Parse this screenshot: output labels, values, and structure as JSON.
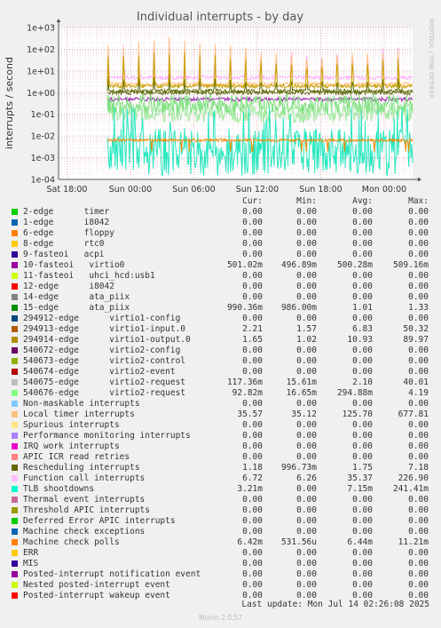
{
  "chart_data": {
    "type": "line",
    "title": "Individual interrupts - by day",
    "ylabel": "interrupts / second",
    "scale": "log",
    "ylim": [
      0.0001,
      1000
    ],
    "yticks": [
      "1e+03",
      "1e+02",
      "1e+01",
      "1e+00",
      "1e-01",
      "1e-02",
      "1e-03",
      "1e-04"
    ],
    "xticks": [
      "Sat 18:00",
      "Sun 00:00",
      "Sun 06:00",
      "Sun 12:00",
      "Sun 18:00",
      "Mon 00:00"
    ],
    "grid": true,
    "series": [
      {
        "name": "Function call interrupts",
        "color": "#ffb3ff",
        "base": 5,
        "spikes": 300
      },
      {
        "name": "Local timer interrupts",
        "color": "#ffc080",
        "base": 2.5,
        "spikes": 350
      },
      {
        "name": "10-fasteoi virtio0",
        "color": "#9c27b0",
        "base": 0.5,
        "spikes": 0.5
      },
      {
        "name": "15-edge ata_piix",
        "color": "#6b6b1a",
        "base": 1.0,
        "spikes": 1.3
      },
      {
        "name": "Rescheduling interrupts",
        "color": "#556b00",
        "base": 1.2,
        "spikes": 7
      },
      {
        "name": "294914-edge virtio1-output.0",
        "color": "#c8a000",
        "base": 2.0,
        "spikes": 90
      },
      {
        "name": "540675-edge virtio2-request",
        "color": "#a0e8a0",
        "base": 0.12,
        "spikes": 1
      },
      {
        "name": "540676-edge virtio2-request",
        "color": "#80e080",
        "base": 0.3,
        "spikes": 4
      },
      {
        "name": "TLB shootdowns",
        "color": "#28e8c0",
        "base": 0.003,
        "spikes": 0.24
      },
      {
        "name": "Machine check polls",
        "color": "#f08a00",
        "base": 0.0065,
        "spikes": 0.011
      }
    ]
  },
  "legend": {
    "headers": [
      "Cur:",
      "Min:",
      "Avg:",
      "Max:"
    ],
    "rows": [
      {
        "name": "2-edge      timer",
        "color": "#00cc00",
        "cur": "0.00",
        "min": "0.00",
        "avg": "0.00",
        "max": "0.00"
      },
      {
        "name": "1-edge      i8042",
        "color": "#0066b3",
        "cur": "0.00",
        "min": "0.00",
        "avg": "0.00",
        "max": "0.00"
      },
      {
        "name": "6-edge      floppy",
        "color": "#ff8000",
        "cur": "0.00",
        "min": "0.00",
        "avg": "0.00",
        "max": "0.00"
      },
      {
        "name": "8-edge      rtc0",
        "color": "#ffcc00",
        "cur": "0.00",
        "min": "0.00",
        "avg": "0.00",
        "max": "0.00"
      },
      {
        "name": "9-fasteoi   acpi",
        "color": "#330099",
        "cur": "0.00",
        "min": "0.00",
        "avg": "0.00",
        "max": "0.00"
      },
      {
        "name": "10-fasteoi   virtio0",
        "color": "#990099",
        "cur": "501.02m",
        "min": "496.89m",
        "avg": "500.28m",
        "max": "509.16m"
      },
      {
        "name": "11-fasteoi   uhci_hcd:usb1",
        "color": "#ccff00",
        "cur": "0.00",
        "min": "0.00",
        "avg": "0.00",
        "max": "0.00"
      },
      {
        "name": "12-edge      i8042",
        "color": "#ff0000",
        "cur": "0.00",
        "min": "0.00",
        "avg": "0.00",
        "max": "0.00"
      },
      {
        "name": "14-edge      ata_piix",
        "color": "#808080",
        "cur": "0.00",
        "min": "0.00",
        "avg": "0.00",
        "max": "0.00"
      },
      {
        "name": "15-edge      ata_piix",
        "color": "#008f00",
        "cur": "990.36m",
        "min": "986.00m",
        "avg": "1.01",
        "max": "1.33"
      },
      {
        "name": "294912-edge      virtio1-config",
        "color": "#00487d",
        "cur": "0.00",
        "min": "0.00",
        "avg": "0.00",
        "max": "0.00"
      },
      {
        "name": "294913-edge      virtio1-input.0",
        "color": "#b35a00",
        "cur": "2.21",
        "min": "1.57",
        "avg": "6.83",
        "max": "50.32"
      },
      {
        "name": "294914-edge      virtio1-output.0",
        "color": "#b38f00",
        "cur": "1.65",
        "min": "1.02",
        "avg": "10.93",
        "max": "89.97"
      },
      {
        "name": "540672-edge      virtio2-config",
        "color": "#6b006b",
        "cur": "0.00",
        "min": "0.00",
        "avg": "0.00",
        "max": "0.00"
      },
      {
        "name": "540673-edge      virtio2-control",
        "color": "#8fb300",
        "cur": "0.00",
        "min": "0.00",
        "avg": "0.00",
        "max": "0.00"
      },
      {
        "name": "540674-edge      virtio2-event",
        "color": "#b30000",
        "cur": "0.00",
        "min": "0.00",
        "avg": "0.00",
        "max": "0.00"
      },
      {
        "name": "540675-edge      virtio2-request",
        "color": "#bebebe",
        "cur": "117.36m",
        "min": "15.61m",
        "avg": "2.10",
        "max": "40.01"
      },
      {
        "name": "540676-edge      virtio2-request",
        "color": "#80ff80",
        "cur": "92.82m",
        "min": "16.65m",
        "avg": "294.88m",
        "max": "4.19"
      },
      {
        "name": "Non-maskable interrupts",
        "color": "#80c9ff",
        "cur": "0.00",
        "min": "0.00",
        "avg": "0.00",
        "max": "0.00"
      },
      {
        "name": "Local timer interrupts",
        "color": "#ffc080",
        "cur": "35.57",
        "min": "35.12",
        "avg": "125.70",
        "max": "677.81"
      },
      {
        "name": "Spurious interrupts",
        "color": "#ffe680",
        "cur": "0.00",
        "min": "0.00",
        "avg": "0.00",
        "max": "0.00"
      },
      {
        "name": "Performance monitoring interrupts",
        "color": "#aa80ff",
        "cur": "0.00",
        "min": "0.00",
        "avg": "0.00",
        "max": "0.00"
      },
      {
        "name": "IRQ work interrupts",
        "color": "#ee00cc",
        "cur": "0.00",
        "min": "0.00",
        "avg": "0.00",
        "max": "0.00"
      },
      {
        "name": "APIC ICR read retries",
        "color": "#ff8080",
        "cur": "0.00",
        "min": "0.00",
        "avg": "0.00",
        "max": "0.00"
      },
      {
        "name": "Rescheduling interrupts",
        "color": "#666600",
        "cur": "1.18",
        "min": "996.73m",
        "avg": "1.75",
        "max": "7.18"
      },
      {
        "name": "Function call interrupts",
        "color": "#ffbfff",
        "cur": "6.72",
        "min": "6.26",
        "avg": "35.37",
        "max": "226.90"
      },
      {
        "name": "TLB shootdowns",
        "color": "#00ffcc",
        "cur": "3.21m",
        "min": "0.00",
        "avg": "7.15m",
        "max": "241.41m"
      },
      {
        "name": "Thermal event interrupts",
        "color": "#cc6699",
        "cur": "0.00",
        "min": "0.00",
        "avg": "0.00",
        "max": "0.00"
      },
      {
        "name": "Threshold APIC interrupts",
        "color": "#999900",
        "cur": "0.00",
        "min": "0.00",
        "avg": "0.00",
        "max": "0.00"
      },
      {
        "name": "Deferred Error APIC interrupts",
        "color": "#00cc00",
        "cur": "0.00",
        "min": "0.00",
        "avg": "0.00",
        "max": "0.00"
      },
      {
        "name": "Machine check exceptions",
        "color": "#0066b3",
        "cur": "0.00",
        "min": "0.00",
        "avg": "0.00",
        "max": "0.00"
      },
      {
        "name": "Machine check polls",
        "color": "#ff8000",
        "cur": "6.42m",
        "min": "531.56u",
        "avg": "6.44m",
        "max": "11.21m"
      },
      {
        "name": "ERR",
        "color": "#ffcc00",
        "cur": "0.00",
        "min": "0.00",
        "avg": "0.00",
        "max": "0.00"
      },
      {
        "name": "MIS",
        "color": "#330099",
        "cur": "0.00",
        "min": "0.00",
        "avg": "0.00",
        "max": "0.00"
      },
      {
        "name": "Posted-interrupt notification event",
        "color": "#990099",
        "cur": "0.00",
        "min": "0.00",
        "avg": "0.00",
        "max": "0.00"
      },
      {
        "name": "Nested posted-interrupt event",
        "color": "#ccff00",
        "cur": "0.00",
        "min": "0.00",
        "avg": "0.00",
        "max": "0.00"
      },
      {
        "name": "Posted-interrupt wakeup event",
        "color": "#ff0000",
        "cur": "0.00",
        "min": "0.00",
        "avg": "0.00",
        "max": "0.00"
      }
    ]
  },
  "footer": {
    "last_update": "Last update: Mon Jul 14 02:26:08 2025",
    "version": "Munin 2.0.57",
    "side_label": "RRDTOOL / TOBI OETIKER"
  }
}
